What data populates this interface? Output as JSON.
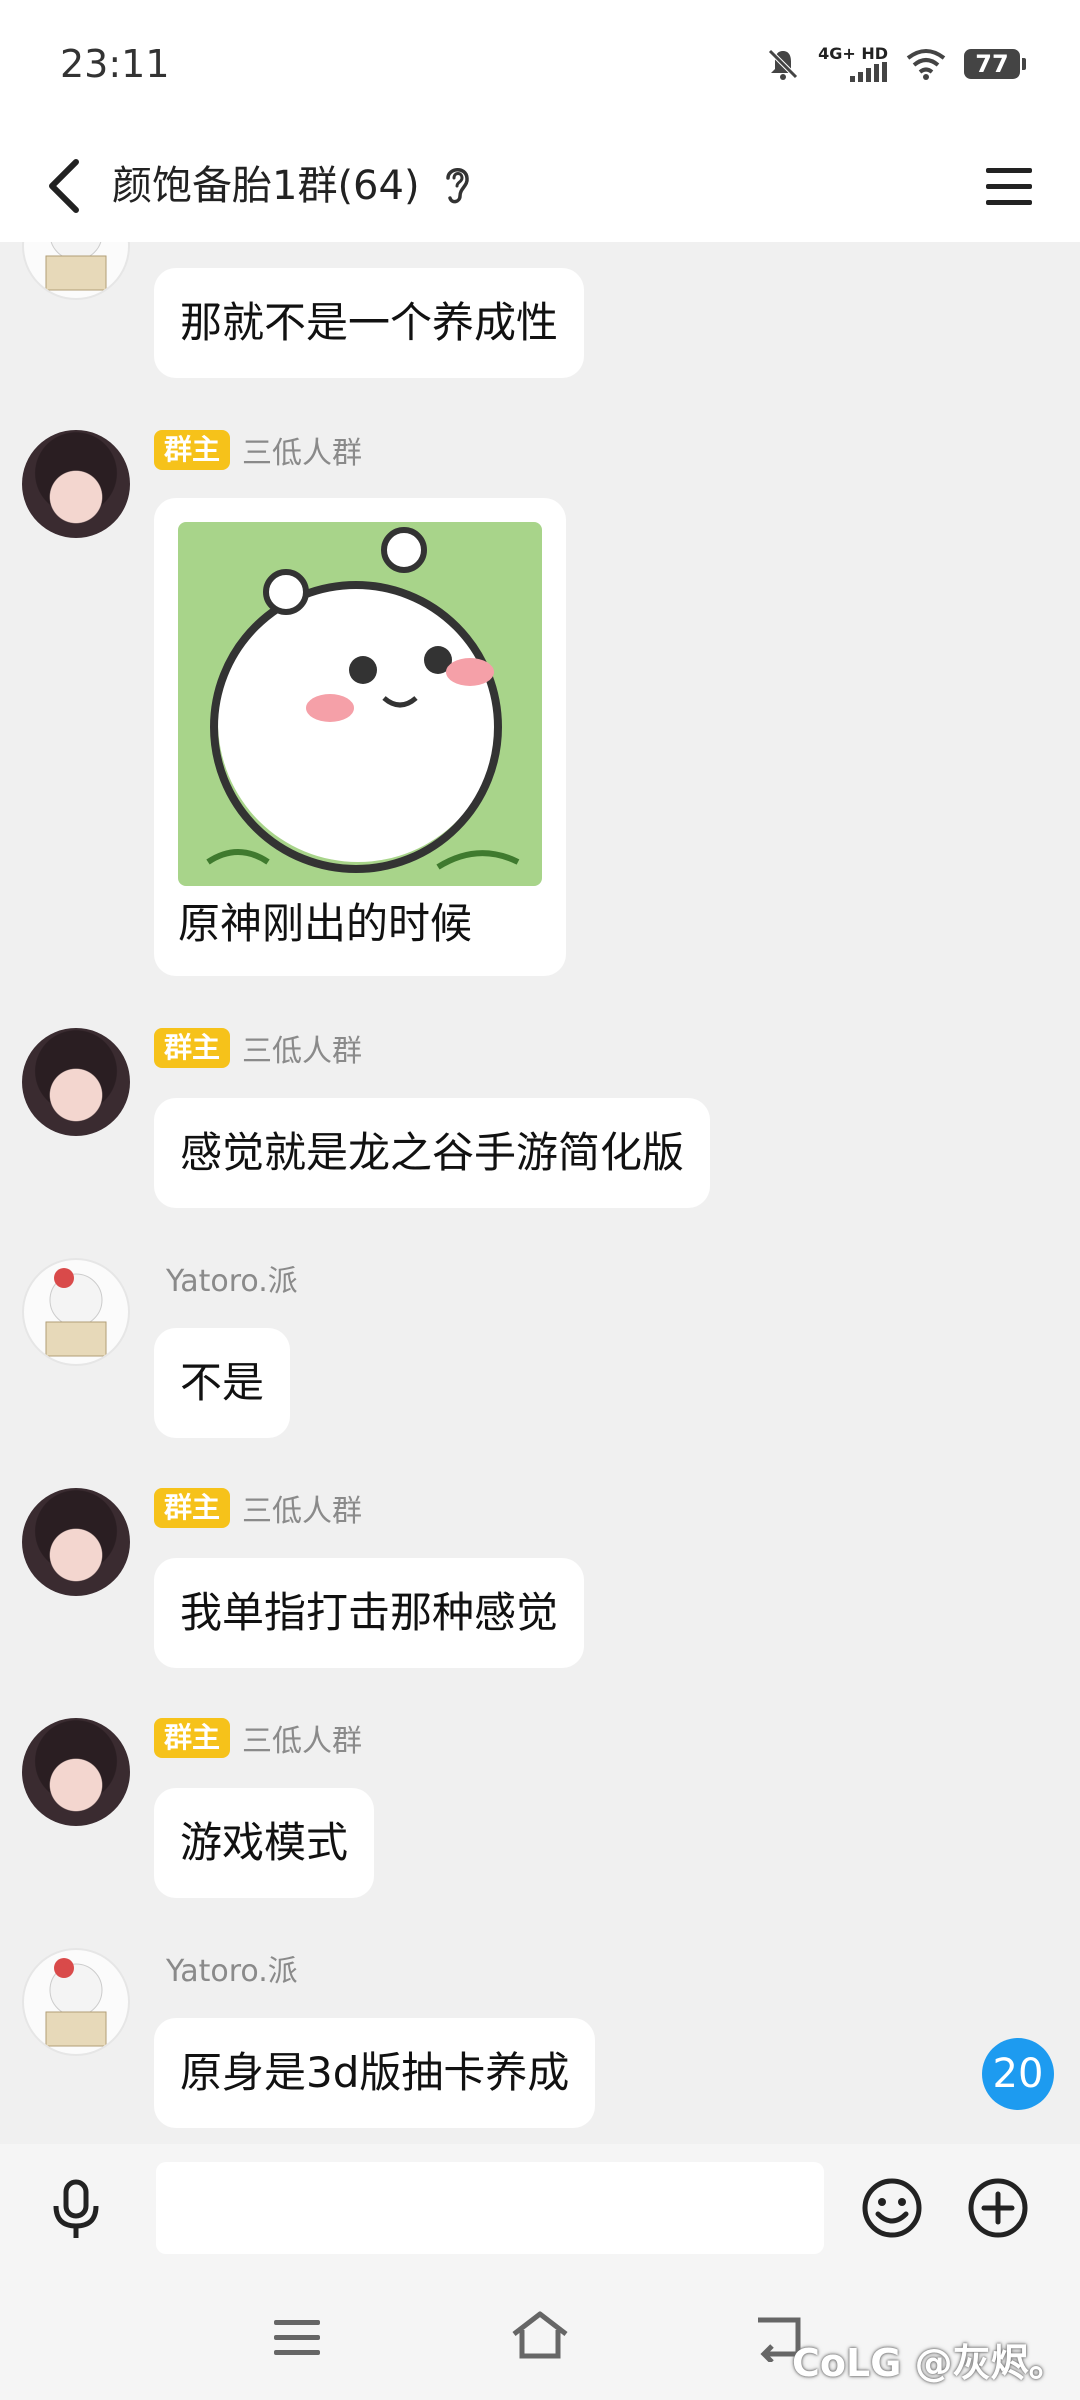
{
  "status_bar": {
    "time": "23:11",
    "network_label": "4G+ HD",
    "battery": "77",
    "icons": [
      "bell-muted-icon",
      "signal-icon",
      "wifi-icon",
      "battery-icon"
    ]
  },
  "header": {
    "title": "颜饱备胎1群(64)",
    "icons": [
      "back-arrow-icon",
      "ear-icon",
      "hamburger-menu-icon"
    ]
  },
  "badges": {
    "owner": "群主"
  },
  "messages": [
    {
      "sender": "",
      "role": "",
      "text": "那就不是一个养成性"
    },
    {
      "sender": "三低人群",
      "role": "群主",
      "caption": "原神刚出的时候",
      "image": "hamster-sticker"
    },
    {
      "sender": "三低人群",
      "role": "群主",
      "text": "感觉就是龙之谷手游简化版"
    },
    {
      "sender": "Yatoro.派",
      "role": "",
      "text": "不是"
    },
    {
      "sender": "三低人群",
      "role": "群主",
      "text": "我单指打击那种感觉"
    },
    {
      "sender": "三低人群",
      "role": "群主",
      "text": "游戏模式"
    },
    {
      "sender": "Yatoro.派",
      "role": "",
      "text": "原身是3d版抽卡养成"
    }
  ],
  "unread_count": "20",
  "input_bar": {
    "value": "",
    "icons": [
      "microphone-icon",
      "emoji-icon",
      "plus-icon"
    ]
  },
  "nav_bar": {
    "icons": [
      "nav-menu-icon",
      "nav-home-icon",
      "nav-back-icon"
    ],
    "watermark": "CoLG @灰烬。"
  },
  "colors": {
    "accent": "#1d9bf0",
    "owner_badge": "#f6c21a",
    "chat_background": "#f0f0f0",
    "sticker_green": "#a8d48a"
  }
}
